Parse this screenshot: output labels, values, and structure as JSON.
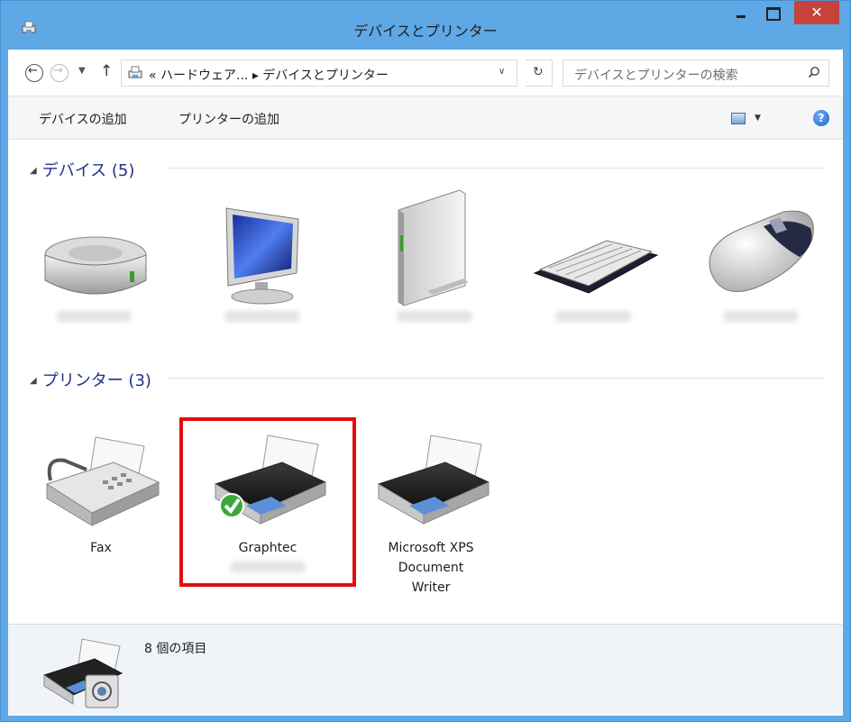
{
  "window": {
    "title": "デバイスとプリンター",
    "close_glyph": "✕"
  },
  "address_bar": {
    "back_icon": "back-arrow-icon",
    "forward_icon": "forward-arrow-icon",
    "path": "« ハードウェア... ▸ デバイスとプリンター",
    "search_placeholder": "デバイスとプリンターの検索"
  },
  "command_bar": {
    "add_device": "デバイスの追加",
    "add_printer": "プリンターの追加",
    "help_glyph": "?"
  },
  "groups": {
    "devices": {
      "header": "デバイス (5)",
      "items": [
        {
          "icon": "hard-drive-icon"
        },
        {
          "icon": "monitor-icon"
        },
        {
          "icon": "tower-computer-icon"
        },
        {
          "icon": "keyboard-icon"
        },
        {
          "icon": "mouse-icon"
        }
      ]
    },
    "printers": {
      "header": "プリンター (3)",
      "items": [
        {
          "label": "Fax",
          "icon": "fax-icon"
        },
        {
          "label": "Graphtec",
          "icon": "printer-icon",
          "default": true
        },
        {
          "label": "Microsoft XPS Document Writer",
          "icon": "printer-icon"
        }
      ]
    }
  },
  "details_pane": {
    "item_count": "8 個の項目"
  },
  "colors": {
    "title_bar": "#5ea8e6",
    "close_button": "#c7423a",
    "group_header": "#1e3287",
    "highlight_box": "#e00f0f"
  }
}
